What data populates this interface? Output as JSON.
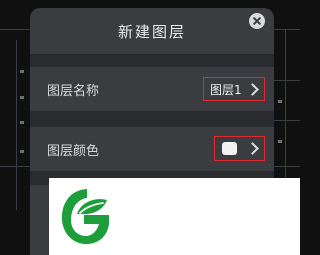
{
  "dialog": {
    "title": "新建图层",
    "rows": [
      {
        "label": "图层名称",
        "value": "图层1"
      },
      {
        "label": "图层颜色",
        "value_color": "#f2f2f2"
      }
    ]
  },
  "colors": {
    "background": "#101010",
    "dialog": "#3b3c40",
    "highlight": "#e0282d",
    "logo_green": "#1e9e3a"
  }
}
